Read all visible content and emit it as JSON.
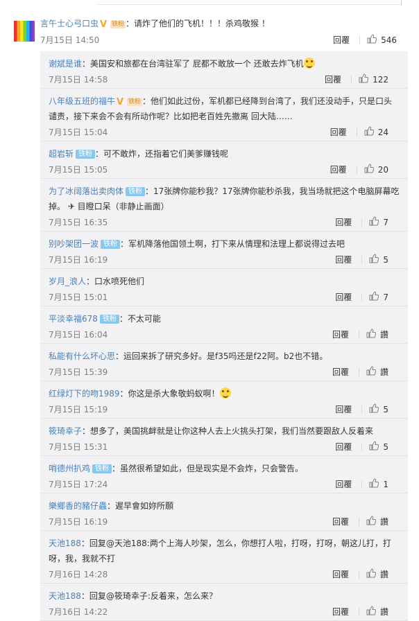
{
  "top_comment": {
    "user": "言午士心弓口虫",
    "fan_badge": "铁粉",
    "text": "：请炸了他们的飞机！！！杀鸡敬猴 ！",
    "time": "7月15日 14:50",
    "reply_label": "回覆",
    "likes": "546"
  },
  "replies": [
    {
      "user": "谢斌是谁",
      "badge": "",
      "text": "：美国安和旅都在台湾驻军了 屁都不敢放一个 还敢去炸飞机",
      "emoji": true,
      "time": "7月15日 14:58",
      "reply_label": "回覆",
      "likes": "122"
    },
    {
      "user": "八年级五班的福牛",
      "v": true,
      "fan_badge": "铁粉",
      "text": "：他们如此过份，军机都已经降到台湾了，我们还没动手，只是口头谴责，接下来会不会有所动作呢？比如把老百姓先撤离 回大陆……",
      "time": "7月15日 15:04",
      "reply_label": "回覆",
      "likes": "24"
    },
    {
      "user": "超岩斩",
      "badge": "铁粉",
      "text": "：可不敢炸，还指着它们美爹赚钱呢",
      "time": "7月15日 15:05",
      "reply_label": "回覆",
      "likes": "20"
    },
    {
      "user": "为了冰阔落出卖肉体",
      "badge": "铁粉",
      "text": "：17张牌你能秒我？17张牌你能秒杀我，我当场就把这个电脑屏幕吃掉。 ✈ 目瞪口呆（非静止画面）",
      "time": "7月15日 16:35",
      "reply_label": "回覆",
      "likes": "7"
    },
    {
      "user": "别吵架团一波",
      "badge": "铁粉",
      "text": "：军机降落他国领土啊，打下来从情理和法理上都说得过去吧",
      "time": "7月15日 16:19",
      "reply_label": "回覆",
      "likes": "5"
    },
    {
      "user": "岁月_浪人",
      "badge": "",
      "text": "：口水喷死他们",
      "time": "7月15日 15:01",
      "reply_label": "回覆",
      "likes": "7"
    },
    {
      "user": "平淡幸福678",
      "badge": "铁粉",
      "text": "：不太可能",
      "time": "7月15日 16:04",
      "reply_label": "回覆",
      "likes": "讚"
    },
    {
      "user": "私能有什么坏心思",
      "badge": "",
      "text": "：运回来拆了研究多好。是f35吗还是f22阿。b2也不错。",
      "time": "7月15日 15:39",
      "reply_label": "回覆",
      "likes": "讚"
    },
    {
      "user": "红绿灯下的吻1989",
      "badge": "",
      "text": "：你这是杀大象敬蚂蚁啊！",
      "emoji": true,
      "time": "7月15日 15:19",
      "reply_label": "回覆",
      "likes": "5"
    },
    {
      "user": "筱琦幸子",
      "badge": "",
      "text": "：想多了，美国挑衅就是让你这种人去上火挑头打架，我们当然要跟敌人反着来",
      "time": "7月15日 15:31",
      "reply_label": "回覆",
      "likes": "5"
    },
    {
      "user": "哨德州扒鸡",
      "badge": "铁粉",
      "text": "：虽然很希望如此，但是现实是不会炸，只会警告。",
      "time": "7月15日 17:24",
      "reply_label": "回覆",
      "likes": "1"
    },
    {
      "user": "樂鄉香的豬仔蟲",
      "badge": "",
      "text": "：遲早會如妳所願",
      "time": "7月15日 16:19",
      "reply_label": "回覆",
      "likes": "讚"
    },
    {
      "user": "天池188",
      "badge": "",
      "text": "：回复@天池188:两个上海人吵架，怎么，你想打人啦，打呀，打呀，朝这儿打，打呀，我，我就不打",
      "time": "7月16日 14:28",
      "reply_label": "回覆",
      "likes": "讚"
    },
    {
      "user": "天池188",
      "badge": "",
      "text": "：回复@筱琦幸子:反着来，怎么来？",
      "time": "7月16日 14:22",
      "reply_label": "回覆",
      "likes": "讚"
    }
  ]
}
